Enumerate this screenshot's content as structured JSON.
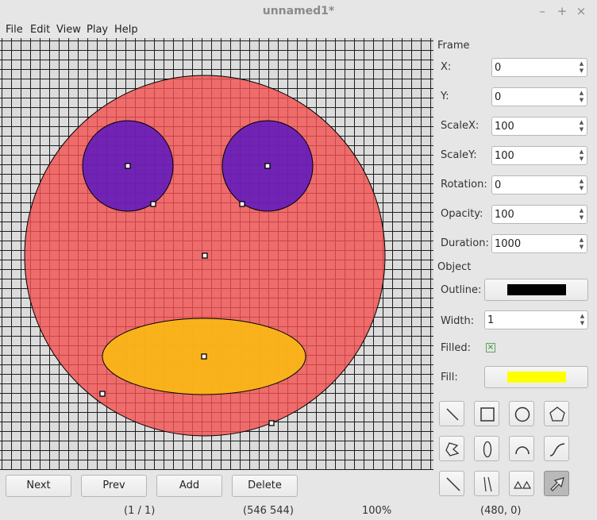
{
  "window": {
    "title": "unnamed1*"
  },
  "menu": [
    "File",
    "Edit",
    "View",
    "Play",
    "Help"
  ],
  "colors": {
    "face": "#f35050",
    "eyes": "#5b17c0",
    "mouth": "#fbba14",
    "outline": "#000000",
    "fill": "#ffff00"
  },
  "panel": {
    "frame_heading": "Frame",
    "fields": [
      {
        "label": "X:",
        "value": "0"
      },
      {
        "label": "Y:",
        "value": "0"
      },
      {
        "label": "ScaleX:",
        "value": "100"
      },
      {
        "label": "ScaleY:",
        "value": "100"
      },
      {
        "label": "Rotation:",
        "value": "0"
      },
      {
        "label": "Opacity:",
        "value": "100"
      },
      {
        "label": "Duration:",
        "value": "1000"
      }
    ],
    "object_heading": "Object",
    "outline_label": "Outline:",
    "width_label": "Width:",
    "width_value": "1",
    "filled_label": "Filled:",
    "filled_checked": true,
    "fill_label": "Fill:"
  },
  "tools": [
    {
      "name": "line-tool-icon"
    },
    {
      "name": "rectangle-tool-icon"
    },
    {
      "name": "circle-tool-icon"
    },
    {
      "name": "pentagon-tool-icon"
    },
    {
      "name": "polygon-tool-icon"
    },
    {
      "name": "ellipse-tool-icon"
    },
    {
      "name": "arc-tool-icon"
    },
    {
      "name": "curve-tool-icon"
    },
    {
      "name": "diagonal-line-tool-icon"
    },
    {
      "name": "double-line-tool-icon"
    },
    {
      "name": "triangles-tool-icon"
    },
    {
      "name": "select-arrow-tool-icon",
      "active": true
    }
  ],
  "buttons": {
    "next": "Next",
    "prev": "Prev",
    "add": "Add",
    "delete": "Delete"
  },
  "status": {
    "frame": "(1 / 1)",
    "size": "(546 544)",
    "zoom": "100%",
    "cursor": "(480, 0)"
  }
}
